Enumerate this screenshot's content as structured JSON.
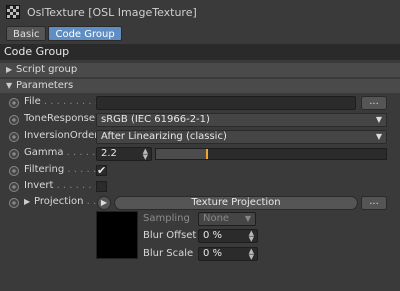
{
  "window": {
    "title": "OslTexture [OSL ImageTexture]"
  },
  "tabs": [
    {
      "label": "Basic",
      "active": false
    },
    {
      "label": "Code Group",
      "active": true
    }
  ],
  "group_header": "Code Group",
  "sections": {
    "script_group": "Script group",
    "parameters": "Parameters"
  },
  "params": {
    "file": {
      "label": "File",
      "dots": " . . . . . . . . . . .",
      "value": "",
      "browse_label": "..."
    },
    "tone_response": {
      "label": "ToneResponse",
      "value": "sRGB (IEC 61966-2-1)"
    },
    "inversion_order": {
      "label": "InversionOrder",
      "value": "After Linearizing (classic)"
    },
    "gamma": {
      "label": "Gamma",
      "dots": " . . . . . . .",
      "value": "2.2",
      "slider_fraction": 0.22
    },
    "filtering": {
      "label": "Filtering",
      "dots": " . . . . . .",
      "checked": true,
      "check_glyph": "✔"
    },
    "invert": {
      "label": "Invert",
      "dots": " . . . . . . . .",
      "checked": false,
      "check_glyph": ""
    },
    "projection": {
      "label": "Projection",
      "dots": " . . .",
      "button_label": "Texture Projection",
      "more_label": "...",
      "sampling": {
        "label": "Sampling",
        "value": "None"
      },
      "blur_offset": {
        "label": "Blur Offset",
        "value": "0 %"
      },
      "blur_scale": {
        "label": "Blur Scale",
        "value": "0 %"
      }
    }
  },
  "colors": {
    "accent_tab": "#5e8ec4",
    "slider_handle": "#f0a830",
    "background": "#3a3a3a"
  }
}
